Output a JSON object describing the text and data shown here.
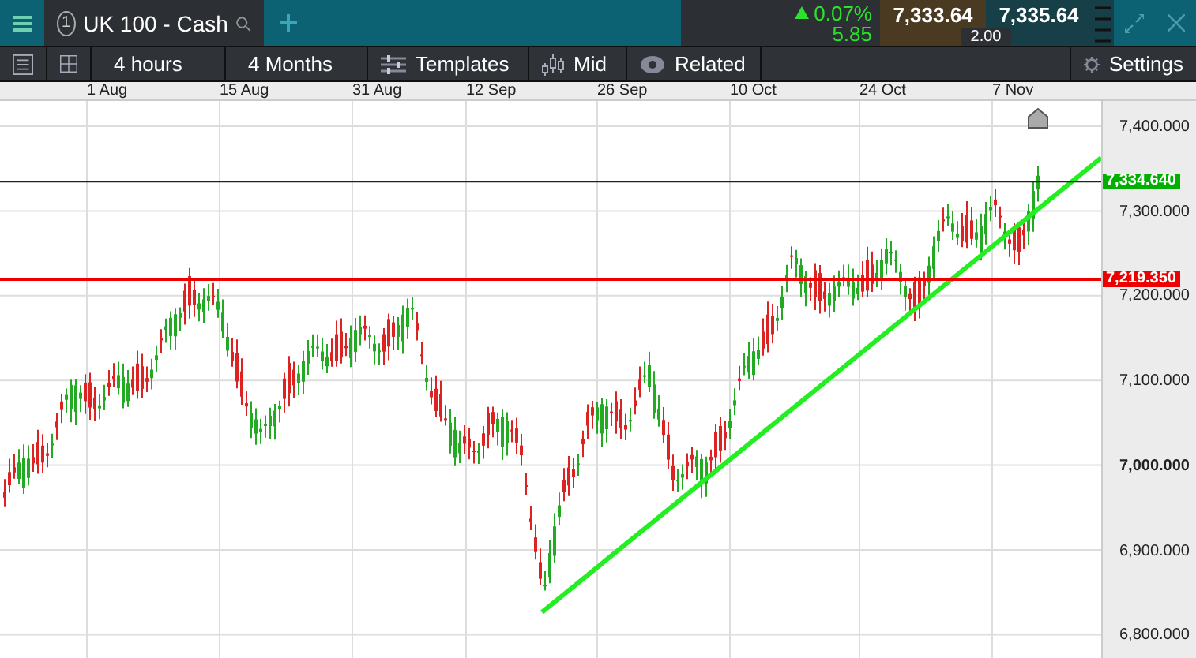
{
  "instrument_tab": {
    "number": "1",
    "name": "UK 100 - Cash"
  },
  "quote": {
    "change_percent": "0.07%",
    "change_points": "5.85",
    "sell": "7,333.64",
    "buy": "7,335.64",
    "spread": "2.00"
  },
  "toolbar": [
    {
      "kind": "icon-list"
    },
    {
      "kind": "icon-layout"
    },
    {
      "kind": "text",
      "label": "4 hours"
    },
    {
      "kind": "text",
      "label": "4 Months"
    },
    {
      "kind": "templates",
      "label": "Templates"
    },
    {
      "kind": "candles",
      "label": "Mid"
    },
    {
      "kind": "eye",
      "label": "Related"
    }
  ],
  "settings": {
    "label": "Settings"
  },
  "date_axis": [
    "1 Aug",
    "15 Aug",
    "31 Aug",
    "12 Sep",
    "26 Sep",
    "10 Oct",
    "24 Oct",
    "7 Nov"
  ],
  "price_axis": [
    "7,400.000",
    "7,300.000",
    "7,200.000",
    "7,100.000",
    "7,000.000",
    "6,900.000",
    "6,800.000"
  ],
  "price_tags": [
    {
      "label": "7,334.640",
      "color": "#00b000"
    },
    {
      "label": "7,219.350",
      "color": "#ee0000"
    }
  ]
}
